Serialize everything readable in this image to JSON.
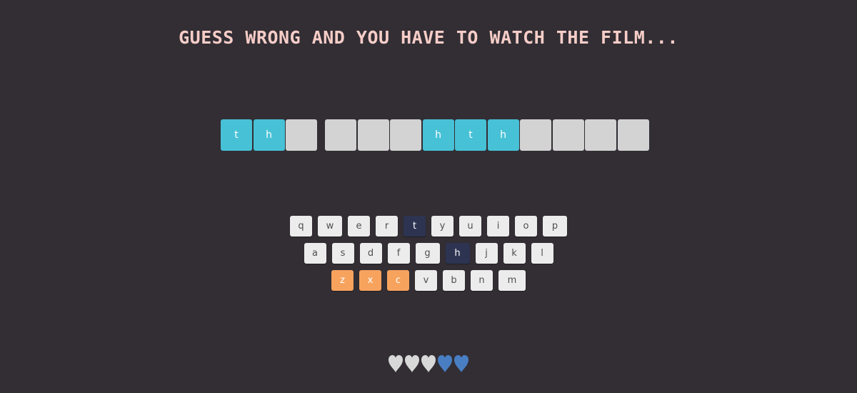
{
  "title": "GUESS WRONG AND YOU HAVE TO WATCH THE FILM...",
  "puzzle": {
    "words": [
      [
        {
          "letter": "t",
          "revealed": true
        },
        {
          "letter": "h",
          "revealed": true
        },
        {
          "letter": "",
          "revealed": false
        }
      ],
      [
        {
          "letter": "",
          "revealed": false
        },
        {
          "letter": "",
          "revealed": false
        },
        {
          "letter": "",
          "revealed": false
        },
        {
          "letter": "h",
          "revealed": true
        },
        {
          "letter": "t",
          "revealed": true
        },
        {
          "letter": "h",
          "revealed": true
        },
        {
          "letter": "",
          "revealed": false
        },
        {
          "letter": "",
          "revealed": false
        },
        {
          "letter": "",
          "revealed": false
        },
        {
          "letter": "",
          "revealed": false
        }
      ]
    ]
  },
  "keyboard": {
    "rows": [
      [
        {
          "key": "q",
          "state": "unused"
        },
        {
          "key": "w",
          "state": "unused"
        },
        {
          "key": "e",
          "state": "unused"
        },
        {
          "key": "r",
          "state": "unused"
        },
        {
          "key": "t",
          "state": "correct"
        },
        {
          "key": "y",
          "state": "unused"
        },
        {
          "key": "u",
          "state": "unused"
        },
        {
          "key": "i",
          "state": "unused"
        },
        {
          "key": "o",
          "state": "unused"
        },
        {
          "key": "p",
          "state": "unused"
        }
      ],
      [
        {
          "key": "a",
          "state": "unused"
        },
        {
          "key": "s",
          "state": "unused"
        },
        {
          "key": "d",
          "state": "unused"
        },
        {
          "key": "f",
          "state": "unused"
        },
        {
          "key": "g",
          "state": "unused"
        },
        {
          "key": "h",
          "state": "correct"
        },
        {
          "key": "j",
          "state": "unused"
        },
        {
          "key": "k",
          "state": "unused"
        },
        {
          "key": "l",
          "state": "unused"
        }
      ],
      [
        {
          "key": "z",
          "state": "wrong"
        },
        {
          "key": "x",
          "state": "wrong"
        },
        {
          "key": "c",
          "state": "wrong"
        },
        {
          "key": "v",
          "state": "unused"
        },
        {
          "key": "b",
          "state": "unused"
        },
        {
          "key": "n",
          "state": "unused"
        },
        {
          "key": "m",
          "state": "unused"
        }
      ]
    ]
  },
  "lives": {
    "total": 5,
    "remaining": 2,
    "used_color": "#d8d8d8",
    "remaining_color": "#4a7ec2",
    "icon": "heart-icon"
  },
  "colors": {
    "background": "#322e34",
    "title": "#f7cdc8",
    "revealed_tile": "#47c1d6",
    "hidden_tile": "#d3d3d3",
    "correct_key": "#2d3452",
    "wrong_key": "#f7a35e",
    "unused_key": "#ececec"
  }
}
